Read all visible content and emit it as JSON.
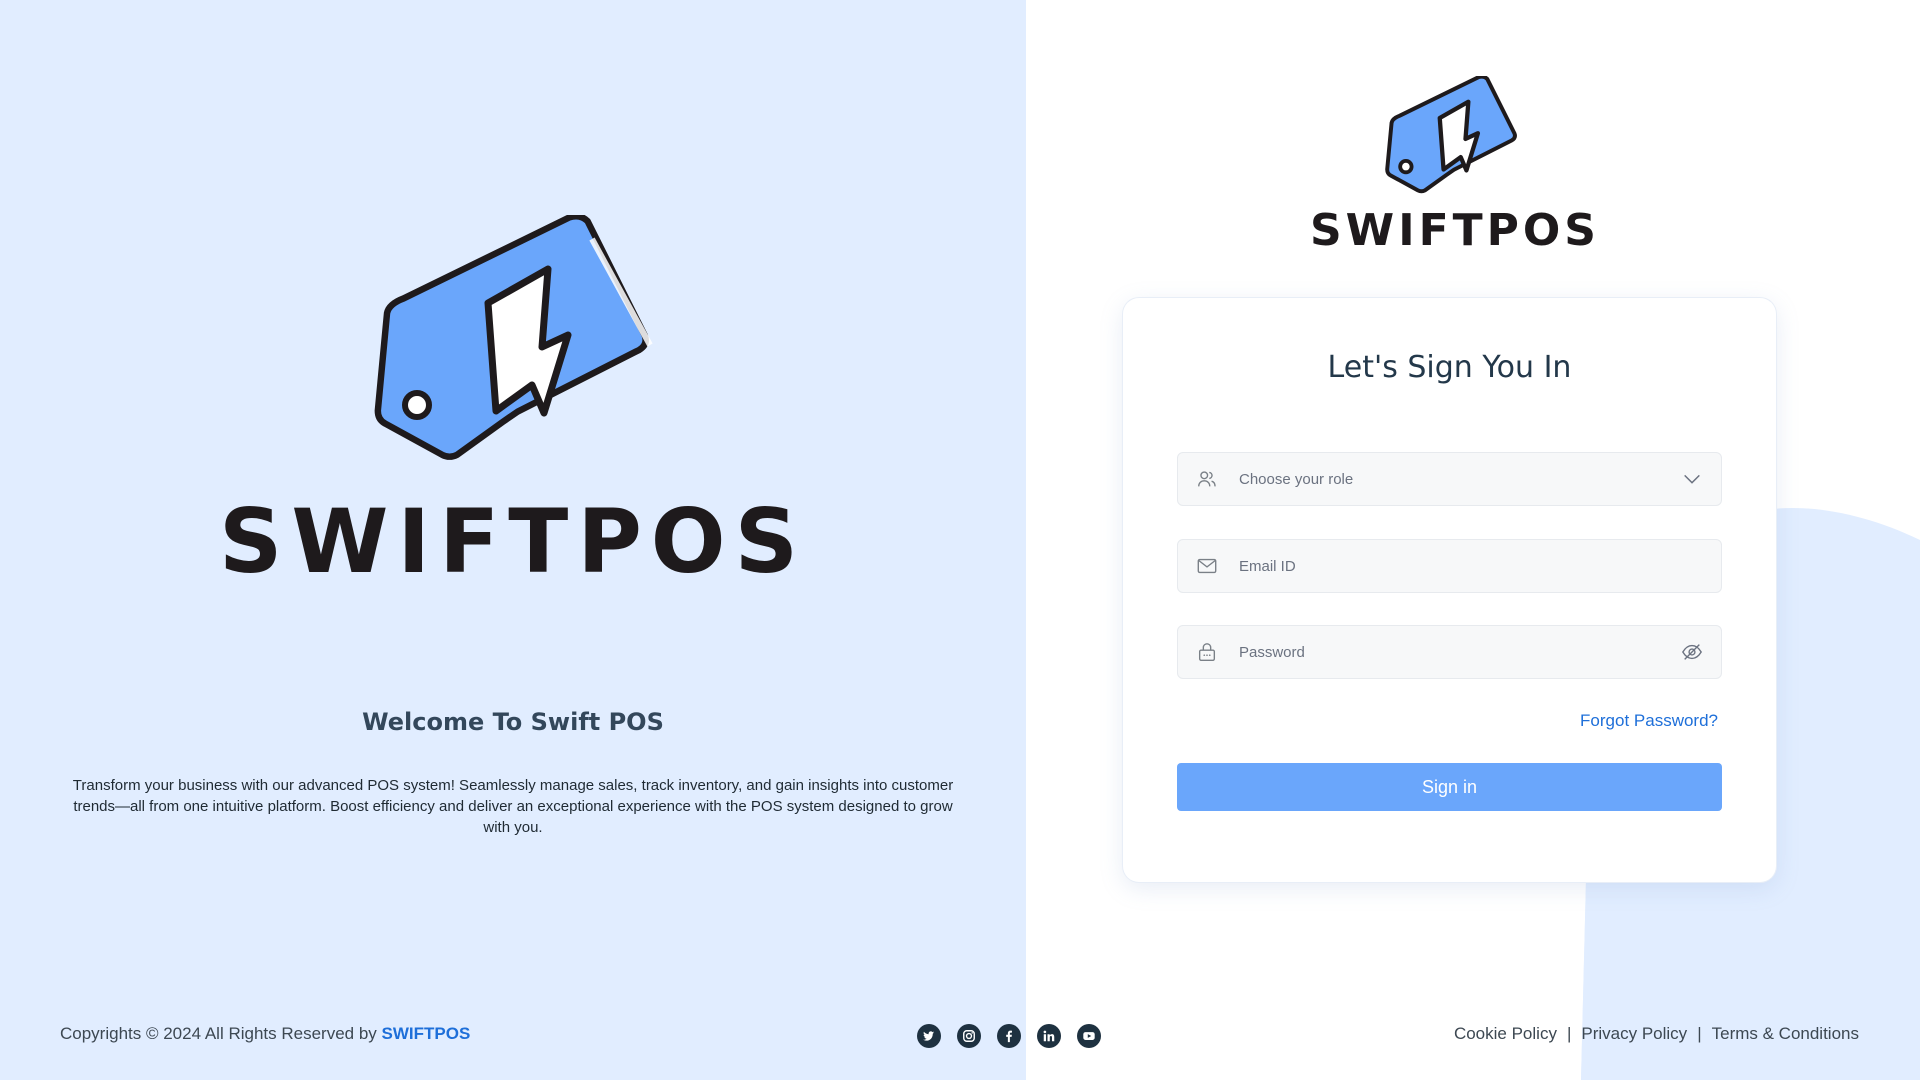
{
  "brand": {
    "name": "SWIFTPOS"
  },
  "hero": {
    "welcome_title": "Welcome To Swift POS",
    "welcome_text": "Transform your business with our advanced POS system! Seamlessly manage sales, track inventory, and gain insights into customer trends—all from one intuitive platform. Boost efficiency and deliver an exceptional experience with the POS system designed to grow with you."
  },
  "login": {
    "title": "Let's Sign You In",
    "role_placeholder": "Choose your role",
    "email_placeholder": "Email ID",
    "password_placeholder": "Password",
    "forgot_label": "Forgot Password?",
    "signin_label": "Sign in"
  },
  "footer": {
    "copyright_prefix": "Copyrights © 2024 All Rights Reserved by",
    "copyright_brand": "SWIFTPOS",
    "links": {
      "cookie": "Cookie Policy",
      "privacy": "Privacy Policy",
      "terms": "Terms & Conditions",
      "separator": "|"
    },
    "socials": [
      "twitter-icon",
      "instagram-icon",
      "facebook-icon",
      "linkedin-icon",
      "youtube-icon"
    ]
  },
  "colors": {
    "left_bg": "#e1edff",
    "accent": "#6aa6fb",
    "link": "#1e6fd9",
    "tag_fill": "#6aa6fb",
    "dark_text": "#1e1a1c"
  }
}
